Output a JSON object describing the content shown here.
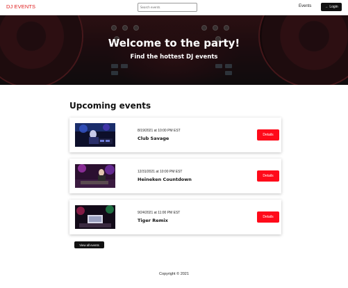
{
  "header": {
    "logo": "DJ EVENTS",
    "search_placeholder": "Search events",
    "nav_events": "Events",
    "login_label": "Login",
    "login_icon": "sign-in-icon"
  },
  "hero": {
    "title": "Welcome to the party!",
    "subtitle": "Find the hottest DJ events"
  },
  "main": {
    "section_title": "Upcoming events",
    "events": [
      {
        "date": "8/19/2021 at 10:00 PM EST",
        "name": "Club Savage",
        "details_label": "Details",
        "thumb": "dj-performance-photo"
      },
      {
        "date": "12/31/2021 at 10:00 PM EST",
        "name": "Heineken Countdown",
        "details_label": "Details",
        "thumb": "dj-performance-photo"
      },
      {
        "date": "9/24/2021 at 11:00 PM EST",
        "name": "Tiger Remix",
        "details_label": "Details",
        "thumb": "dj-performance-photo"
      }
    ],
    "view_all_label": "View all events"
  },
  "footer": {
    "copyright": "Copyright © 2021"
  },
  "colors": {
    "brand_red": "#e02020",
    "details_button": "#ff0a1a",
    "dark_button": "#111111"
  }
}
